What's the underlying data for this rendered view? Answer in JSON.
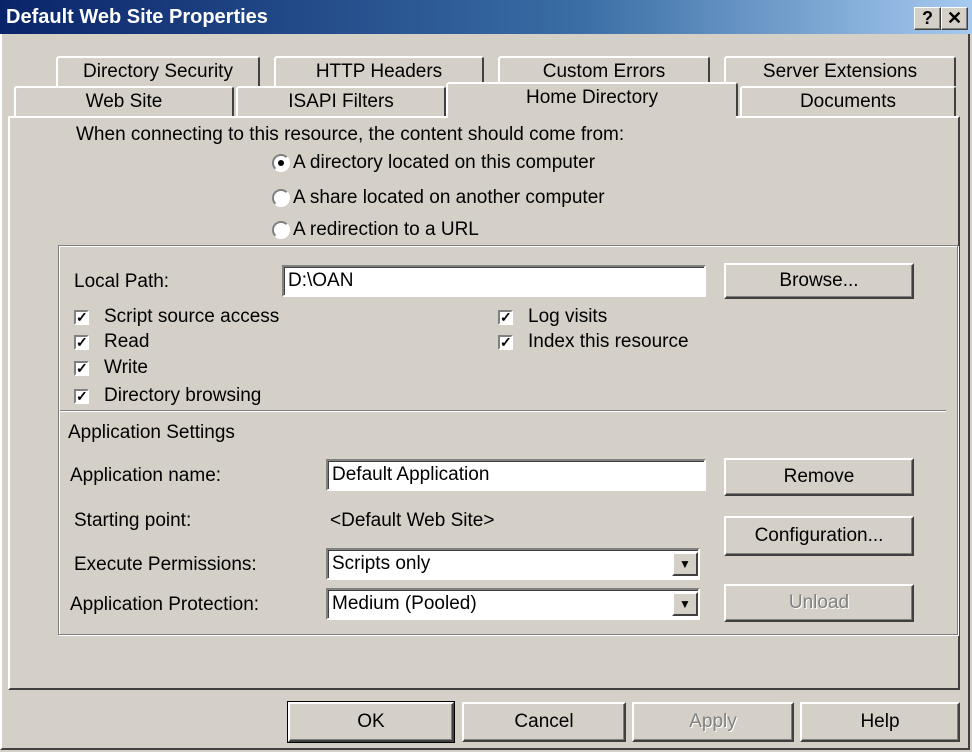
{
  "window": {
    "title": "Default Web Site Properties",
    "help_button": "?",
    "close_button": "✕"
  },
  "tabs_row1": [
    "Directory Security",
    "HTTP Headers",
    "Custom Errors",
    "Server Extensions"
  ],
  "tabs_row2": [
    "Web Site",
    "ISAPI Filters",
    "Home Directory",
    "Documents"
  ],
  "selected_tab": "Home Directory",
  "content_source": {
    "prompt": "When connecting to this resource, the content should come from:",
    "options": [
      "A directory located on this computer",
      "A share located on another computer",
      "A redirection to a URL"
    ],
    "selected_index": 0
  },
  "local_path": {
    "label": "Local Path:",
    "value": "D:\\OAN",
    "browse_label": "Browse..."
  },
  "checkboxes_left": [
    {
      "label": "Script source access",
      "checked": true
    },
    {
      "label": "Read",
      "checked": true
    },
    {
      "label": "Write",
      "checked": true
    },
    {
      "label": "Directory browsing",
      "checked": true
    }
  ],
  "checkboxes_right": [
    {
      "label": "Log visits",
      "checked": true
    },
    {
      "label": "Index this resource",
      "checked": true
    }
  ],
  "app_settings": {
    "heading": "Application Settings",
    "name_label": "Application name:",
    "name_value": "Default Application",
    "remove_label": "Remove",
    "starting_label": "Starting point:",
    "starting_value": "<Default Web Site>",
    "configuration_label": "Configuration...",
    "exec_label": "Execute Permissions:",
    "exec_value": "Scripts only",
    "protection_label": "Application Protection:",
    "protection_value": "Medium (Pooled)",
    "unload_label": "Unload"
  },
  "footer": {
    "ok": "OK",
    "cancel": "Cancel",
    "apply": "Apply",
    "help": "Help"
  },
  "colors": {
    "dialog_bg": "#d4d0c8",
    "titlebar_start": "#0a246a",
    "titlebar_end": "#a6caf0",
    "disabled_text": "#808080"
  }
}
